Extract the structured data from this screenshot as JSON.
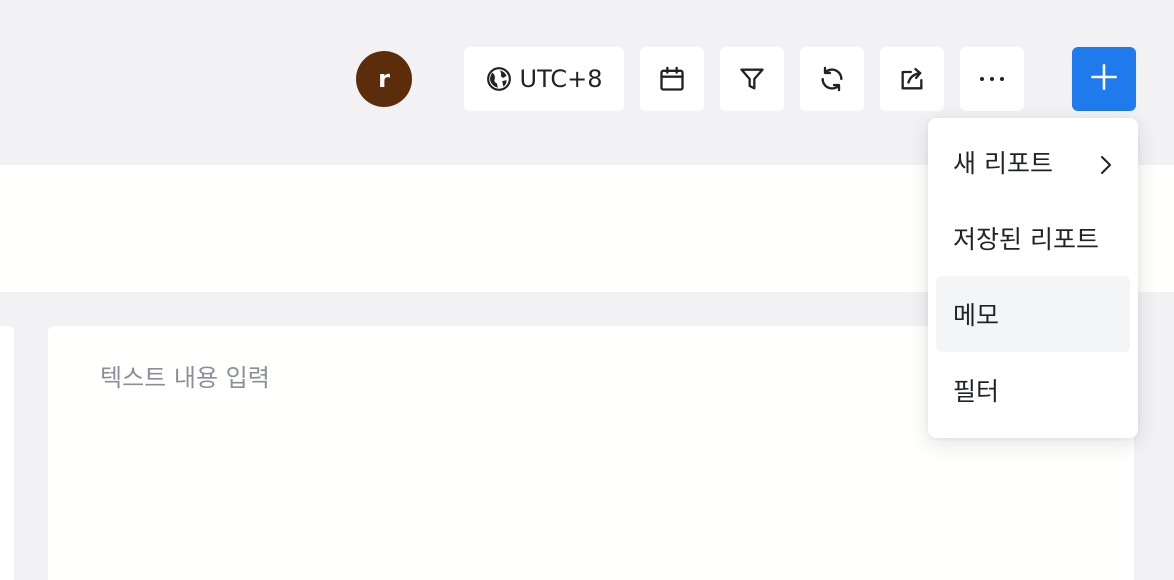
{
  "header": {
    "avatar_initial": "r",
    "timezone_label": "UTC+8",
    "icons": [
      "globe-icon",
      "calendar-icon",
      "filter-icon",
      "refresh-icon",
      "share-icon",
      "more-icon",
      "plus-icon"
    ],
    "accent_color": "#1f7aec",
    "avatar_color": "#5c2d0a"
  },
  "memo": {
    "placeholder": "텍스트 내용 입력"
  },
  "menu": {
    "items": [
      {
        "label": "새 리포트",
        "has_submenu": true
      },
      {
        "label": "저장된 리포트",
        "has_submenu": false
      },
      {
        "label": "메모",
        "has_submenu": false,
        "highlighted": true
      },
      {
        "label": "필터",
        "has_submenu": false
      }
    ]
  }
}
